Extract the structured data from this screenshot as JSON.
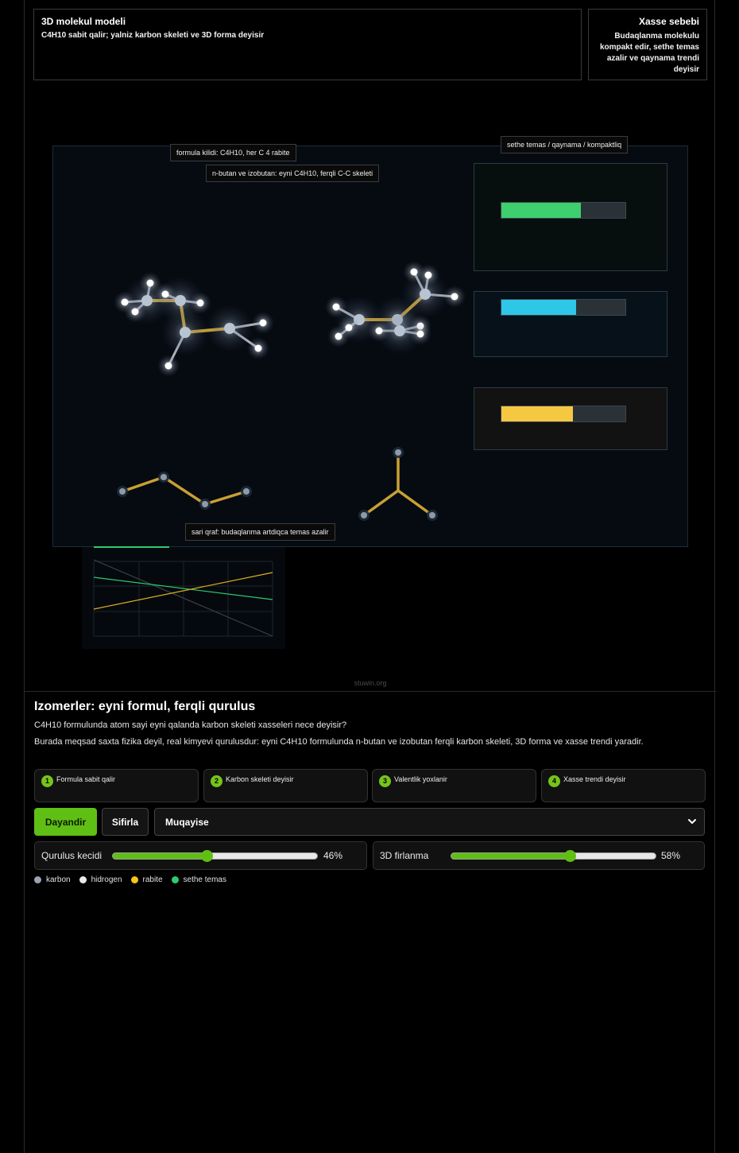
{
  "panel_title": {
    "title": "3D molekul modeli",
    "subtitle": "C4H10 sabit qalir; yalniz karbon skeleti ve 3D forma deyisir"
  },
  "panel_reason": {
    "title": "Xasse sebebi",
    "text": "Budaqlanma molekulu kompakt edir, sethe temas azalir ve qaynama trendi deyisir"
  },
  "scene": {
    "tag_formula_lock": "formula kilidi: C4H10, her C 4 rabite",
    "tag_isomers": "n-butan ve izobutan: eyni C4H10, ferqli C-C skeleti",
    "tag_bars": "sethe temas / qaynama / kompaktliq",
    "tag_graph": "sari qraf: budaqlanma artdiqca temas azalir",
    "bars": [
      {
        "name": "sethe temas",
        "fraction": 0.64,
        "color": "#3ecf6e",
        "box_bg": "#070f0e"
      },
      {
        "name": "qaynama",
        "fraction": 0.6,
        "color": "#2ec7e8",
        "box_bg": "#06111a"
      },
      {
        "name": "kompaktliq",
        "fraction": 0.58,
        "color": "#f5c842",
        "box_bg": "#121212"
      }
    ]
  },
  "credit": "stuwin.org",
  "content": {
    "heading": "Izomerler: eyni formul, ferqli qurulus",
    "lead": "C4H10 formulunda atom sayi eyni qalanda karbon skeleti xasseleri nece deyisir?",
    "desc": "Burada meqsad saxta fizika deyil, real kimyevi qurulusdur: eyni C4H10 formulunda n-butan ve izobutan ferqli karbon skeleti, 3D forma ve xasse trendi yaradir."
  },
  "steps": [
    {
      "num": "1",
      "label": "Formula sabit qalir"
    },
    {
      "num": "2",
      "label": "Karbon skeleti deyisir"
    },
    {
      "num": "3",
      "label": "Valentlik yoxlanir"
    },
    {
      "num": "4",
      "label": "Xasse trendi deyisir"
    }
  ],
  "controls": {
    "pause_label": "Dayandir",
    "reset_label": "Sifirla",
    "mode_selected": "Muqayise"
  },
  "sliders": [
    {
      "label": "Qurulus kecidi",
      "value": 0.46,
      "value_text": "46%"
    },
    {
      "label": "3D firlanma",
      "value": 0.58,
      "value_text": "58%"
    }
  ],
  "legend": [
    {
      "label": "karbon",
      "color": "#9aa4b2"
    },
    {
      "label": "hidrogen",
      "color": "#e9e9e9"
    },
    {
      "label": "rabite",
      "color": "#f5c518"
    },
    {
      "label": "sethe temas",
      "color": "#2ecc71"
    }
  ],
  "colors": {
    "accent": "#5fbf14",
    "bond": "#c9a032",
    "carbon": "#9aa4b2",
    "hydrogen": "#ffffff"
  }
}
